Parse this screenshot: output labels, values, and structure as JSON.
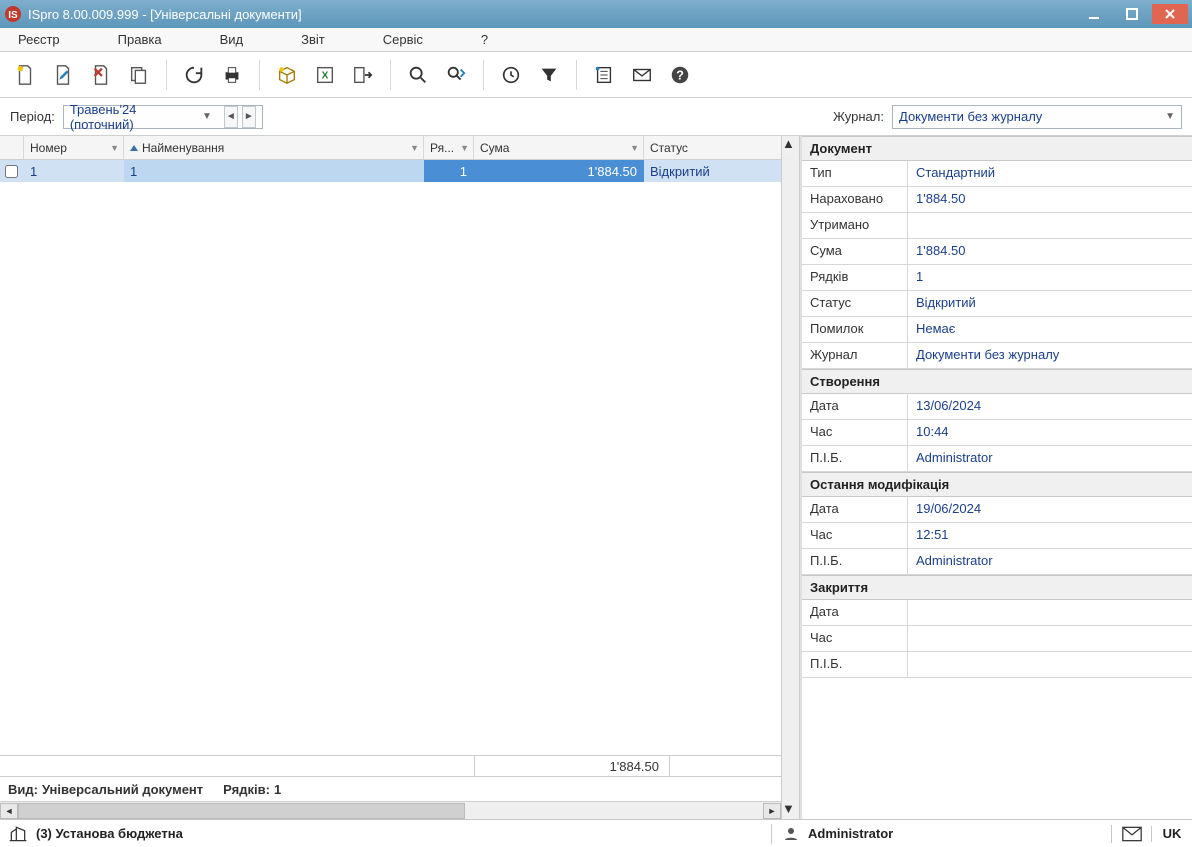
{
  "title": "ISpro 8.00.009.999 - [Універсальні документи]",
  "menu": {
    "registry": "Реєстр",
    "edit": "Правка",
    "view": "Вид",
    "report": "Звіт",
    "service": "Сервіс",
    "help": "?"
  },
  "filter": {
    "period_label": "Період:",
    "period_value": "Травень'24 (поточний)",
    "journal_label": "Журнал:",
    "journal_value": "Документи без журналу"
  },
  "grid": {
    "headers": {
      "number": "Номер",
      "name": "Найменування",
      "rows": "Ря...",
      "sum": "Сума",
      "status": "Статус"
    },
    "rows": [
      {
        "checked": false,
        "number": "1",
        "name": "1",
        "rows": "1",
        "sum": "1'884.50",
        "status": "Відкритий"
      }
    ],
    "footer_sum": "1'884.50",
    "footer_view_label": "Вид:",
    "footer_view_value": "Універсальний документ",
    "footer_rows_label": "Рядків:",
    "footer_rows_value": "1"
  },
  "details": {
    "sections": {
      "document": {
        "title": "Документ",
        "fields": {
          "type_l": "Тип",
          "type_v": "Стандартний",
          "accrued_l": "Нараховано",
          "accrued_v": "1'884.50",
          "withheld_l": "Утримано",
          "withheld_v": "",
          "sum_l": "Сума",
          "sum_v": "1'884.50",
          "rows_l": "Рядків",
          "rows_v": "1",
          "status_l": "Статус",
          "status_v": "Відкритий",
          "errors_l": "Помилок",
          "errors_v": "Немає",
          "journal_l": "Журнал",
          "journal_v": "Документи без журналу"
        }
      },
      "created": {
        "title": "Створення",
        "fields": {
          "date_l": "Дата",
          "date_v": "13/06/2024",
          "time_l": "Час",
          "time_v": "10:44",
          "name_l": "П.І.Б.",
          "name_v": "Administrator"
        }
      },
      "modified": {
        "title": "Остання модифікація",
        "fields": {
          "date_l": "Дата",
          "date_v": "19/06/2024",
          "time_l": "Час",
          "time_v": "12:51",
          "name_l": "П.І.Б.",
          "name_v": "Administrator"
        }
      },
      "closed": {
        "title": "Закриття",
        "fields": {
          "date_l": "Дата",
          "date_v": "",
          "time_l": "Час",
          "time_v": "",
          "name_l": "П.І.Б.",
          "name_v": ""
        }
      }
    }
  },
  "status": {
    "org": "(3) Установа бюджетна",
    "user": "Administrator",
    "lang": "UK"
  }
}
